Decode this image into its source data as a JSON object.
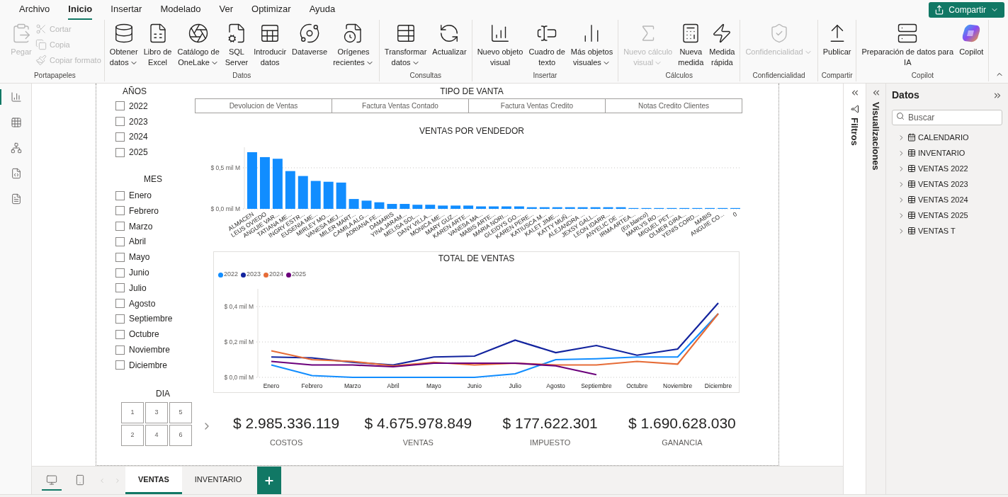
{
  "menu": {
    "tabs": [
      {
        "label": "Archivo",
        "selected": false
      },
      {
        "label": "Inicio",
        "selected": true
      },
      {
        "label": "Insertar",
        "selected": false
      },
      {
        "label": "Modelado",
        "selected": false
      },
      {
        "label": "Ver",
        "selected": false
      },
      {
        "label": "Optimizar",
        "selected": false
      },
      {
        "label": "Ayuda",
        "selected": false
      }
    ],
    "share_button": "Compartir"
  },
  "ribbon": {
    "groups": [
      {
        "label": "Portapapeles",
        "buttons": [
          {
            "kind": "large",
            "lines": [
              "Pegar"
            ],
            "disabled": true,
            "dropdown": false
          },
          {
            "kind": "small",
            "lines": [
              "Cortar"
            ],
            "disabled": true,
            "dropdown": false
          },
          {
            "kind": "small",
            "lines": [
              "Copia"
            ],
            "disabled": true,
            "dropdown": false
          },
          {
            "kind": "small",
            "lines": [
              "Copiar formato"
            ],
            "disabled": true,
            "dropdown": false
          }
        ]
      },
      {
        "label": "Datos",
        "buttons": [
          {
            "kind": "large",
            "lines": [
              "Obtener",
              "datos"
            ],
            "disabled": false,
            "dropdown": true
          },
          {
            "kind": "large",
            "lines": [
              "Libro de",
              "Excel"
            ],
            "disabled": false,
            "dropdown": false
          },
          {
            "kind": "large",
            "lines": [
              "Catálogo de",
              "OneLake"
            ],
            "disabled": false,
            "dropdown": true
          },
          {
            "kind": "large",
            "lines": [
              "SQL",
              "Server"
            ],
            "disabled": false,
            "dropdown": false
          },
          {
            "kind": "large",
            "lines": [
              "Introducir",
              "datos"
            ],
            "disabled": false,
            "dropdown": false
          },
          {
            "kind": "large",
            "lines": [
              "Dataverse"
            ],
            "disabled": false,
            "dropdown": false
          },
          {
            "kind": "large",
            "lines": [
              "Orígenes",
              "recientes"
            ],
            "disabled": false,
            "dropdown": true
          }
        ]
      },
      {
        "label": "Consultas",
        "buttons": [
          {
            "kind": "large",
            "lines": [
              "Transformar",
              "datos"
            ],
            "disabled": false,
            "dropdown": true
          },
          {
            "kind": "large",
            "lines": [
              "Actualizar"
            ],
            "disabled": false,
            "dropdown": false
          }
        ]
      },
      {
        "label": "Insertar",
        "buttons": [
          {
            "kind": "large",
            "lines": [
              "Nuevo objeto",
              "visual"
            ],
            "disabled": false,
            "dropdown": false
          },
          {
            "kind": "large",
            "lines": [
              "Cuadro de",
              "texto"
            ],
            "disabled": false,
            "dropdown": false
          },
          {
            "kind": "large",
            "lines": [
              "Más objetos",
              "visuales"
            ],
            "disabled": false,
            "dropdown": true
          }
        ]
      },
      {
        "label": "Cálculos",
        "buttons": [
          {
            "kind": "large",
            "lines": [
              "Nuevo cálculo",
              "visual"
            ],
            "disabled": true,
            "dropdown": true
          },
          {
            "kind": "large",
            "lines": [
              "Nueva",
              "medida"
            ],
            "disabled": false,
            "dropdown": false
          },
          {
            "kind": "large",
            "lines": [
              "Medida",
              "rápida"
            ],
            "disabled": false,
            "dropdown": false
          }
        ]
      },
      {
        "label": "Confidencialidad",
        "buttons": [
          {
            "kind": "large",
            "lines": [
              "Confidencialidad"
            ],
            "disabled": true,
            "dropdown": true
          }
        ]
      },
      {
        "label": "Compartir",
        "buttons": [
          {
            "kind": "large",
            "lines": [
              "Publicar"
            ],
            "disabled": false,
            "dropdown": false
          }
        ]
      },
      {
        "label": "Copilot",
        "buttons": [
          {
            "kind": "large",
            "lines": [
              "Preparación de datos para",
              "IA"
            ],
            "disabled": false,
            "dropdown": false
          },
          {
            "kind": "large",
            "lines": [
              "Copilot"
            ],
            "disabled": false,
            "dropdown": false
          }
        ]
      }
    ]
  },
  "left_rail": {
    "views": [
      {
        "selected": true
      },
      {
        "selected": false
      },
      {
        "selected": false
      },
      {
        "selected": false
      },
      {
        "selected": false
      }
    ]
  },
  "report": {
    "years": {
      "title": "AÑOS",
      "items": [
        {
          "label": "2022",
          "checked": false
        },
        {
          "label": "2023",
          "checked": false
        },
        {
          "label": "2024",
          "checked": false
        },
        {
          "label": "2025",
          "checked": false
        }
      ]
    },
    "months": {
      "title": "MES",
      "items": [
        {
          "label": "Enero",
          "checked": false
        },
        {
          "label": "Febrero",
          "checked": false
        },
        {
          "label": "Marzo",
          "checked": false
        },
        {
          "label": "Abril",
          "checked": false
        },
        {
          "label": "Mayo",
          "checked": false
        },
        {
          "label": "Junio",
          "checked": false
        },
        {
          "label": "Julio",
          "checked": false
        },
        {
          "label": "Agosto",
          "checked": false
        },
        {
          "label": "Septiembre",
          "checked": false
        },
        {
          "label": "Octubre",
          "checked": false
        },
        {
          "label": "Noviembre",
          "checked": false
        },
        {
          "label": "Diciembre",
          "checked": false
        }
      ]
    },
    "days": {
      "title": "DIA",
      "items": [
        "1",
        "3",
        "5",
        "2",
        "4",
        "6"
      ]
    },
    "sale_type": {
      "title": "TIPO DE VANTA",
      "buttons": [
        "Devolucion de Ventas",
        "Factura Ventas Contado",
        "Factura Ventas Credito",
        "Notas Credito Clientes"
      ]
    },
    "bar_chart": {
      "chart_data": {
        "type": "bar",
        "title": "VENTAS POR VENDEDOR",
        "ylim": [
          0,
          0.75
        ],
        "yticks": [
          {
            "value": 0,
            "label": "$ 0,0 mil M"
          },
          {
            "value": 0.5,
            "label": "$ 0,5 mil M"
          }
        ],
        "categories": [
          "ALMACEN",
          "LEUS OVIEDO",
          "ANGUIE VAR...",
          "TATIANA ME...",
          "INGRY ESTR...",
          "EUSENIA ME...",
          "MIRLEY MO...",
          "VANESA MEJ...",
          "MILER MART...",
          "CAMILA ALG...",
          "ADRIANA FE...",
          "DAMARIS",
          "YINA JARAM...",
          "MELISA SOL...",
          "DANY VILLA...",
          "MONICA ME...",
          "MARY GUZ...",
          "KAREN ARTE...",
          "VANESA MA...",
          "MABIS ARTE...",
          "MARIA NORI...",
          "GLEIDYS GO...",
          "KAREN PERE...",
          "KATIUSCA M...",
          "KALET JIME...",
          "KATTY MUÑ...",
          "ALEJANDRA ...",
          "JEXSY GALL...",
          "LEON IDARR...",
          "ANYELIC DE ...",
          "IRMA ARTEA...",
          "(En blanco)",
          "MARLYS RO...",
          "MIGUEL PET...",
          "OLMER GIRA...",
          "YENIS CORD...",
          "MABIS",
          "ANGUIE CO...",
          "0"
        ],
        "series": [
          {
            "color": "#118dff",
            "values": [
              0.69,
              0.63,
              0.61,
              0.46,
              0.4,
              0.34,
              0.33,
              0.32,
              0.12,
              0.1,
              0.08,
              0.06,
              0.06,
              0.05,
              0.05,
              0.04,
              0.04,
              0.04,
              0.03,
              0.03,
              0.03,
              0.03,
              0.02,
              0.02,
              0.02,
              0.02,
              0.02,
              0.02,
              0.02,
              0.02,
              0.01,
              0.01,
              0.01,
              0.01,
              0.01,
              0.01,
              0.01,
              0.01,
              0.01
            ]
          }
        ]
      }
    },
    "line_chart": {
      "chart_data": {
        "type": "line",
        "title": "TOTAL DE VENTAS",
        "legend": "top-left",
        "ylim": [
          0,
          0.5
        ],
        "yticks": [
          {
            "value": 0,
            "label": "$ 0,0 mil M"
          },
          {
            "value": 0.2,
            "label": "$ 0,2 mil M"
          },
          {
            "value": 0.4,
            "label": "$ 0,4 mil M"
          }
        ],
        "categories": [
          "Enero",
          "Febrero",
          "Marzo",
          "Abril",
          "Mayo",
          "Junio",
          "Julio",
          "Agosto",
          "Septiembre",
          "Octubre",
          "Noviembre",
          "Diciembre"
        ],
        "series": [
          {
            "name": "2022",
            "color": "#118dff",
            "values": [
              0.07,
              0.01,
              0.0,
              0.0,
              0.0,
              0.0,
              0.02,
              0.1,
              0.105,
              0.115,
              0.115,
              0.36
            ]
          },
          {
            "name": "2023",
            "color": "#12239e",
            "values": [
              0.115,
              0.11,
              0.085,
              0.07,
              0.115,
              0.12,
              0.21,
              0.14,
              0.18,
              0.125,
              0.16,
              0.42
            ]
          },
          {
            "name": "2024",
            "color": "#e66c37",
            "values": [
              0.15,
              0.1,
              0.09,
              0.065,
              0.085,
              0.07,
              0.08,
              0.07,
              0.07,
              0.09,
              0.075,
              0.36
            ]
          },
          {
            "name": "2025",
            "color": "#6b007b",
            "values": [
              0.09,
              0.07,
              0.07,
              0.06,
              0.08,
              0.08,
              0.08,
              0.065,
              0.015,
              null,
              null,
              null
            ]
          }
        ]
      }
    },
    "kpis": [
      {
        "value": "$ 2.985.336.119",
        "label": "COSTOS"
      },
      {
        "value": "$ 4.675.978.849",
        "label": "VENTAS"
      },
      {
        "value": "$ 177.622.301",
        "label": "IMPUESTO"
      },
      {
        "value": "$ 1.690.628.030",
        "label": "GANANCIA"
      }
    ]
  },
  "panes": {
    "filters": "Filtros",
    "visualizations": "Visualizaciones",
    "data": {
      "title": "Datos",
      "search": {
        "placeholder": "Buscar"
      },
      "tables": [
        {
          "label": "CALENDARIO",
          "kind": "calendar"
        },
        {
          "label": "INVENTARIO",
          "kind": "table"
        },
        {
          "label": "VENTAS 2022",
          "kind": "table"
        },
        {
          "label": "VENTAS 2023",
          "kind": "table"
        },
        {
          "label": "VENTAS 2024",
          "kind": "table"
        },
        {
          "label": "VENTAS 2025",
          "kind": "table"
        },
        {
          "label": "VENTAS T",
          "kind": "table"
        }
      ]
    }
  },
  "pages": {
    "views": [
      {
        "selected": true
      },
      {
        "selected": false
      }
    ],
    "tabs": [
      {
        "label": "VENTAS",
        "selected": true
      },
      {
        "label": "INVENTARIO",
        "selected": false
      }
    ]
  }
}
